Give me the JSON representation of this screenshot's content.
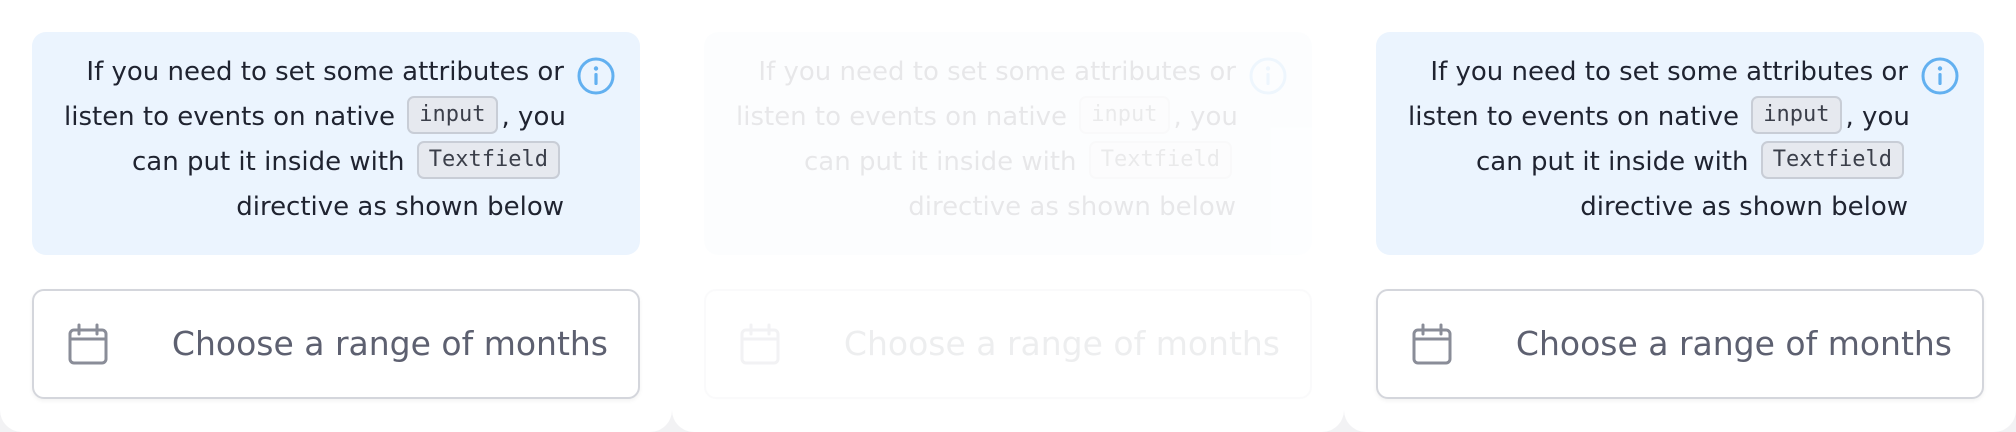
{
  "info": {
    "line1": "If you need to set some attributes or",
    "line2_pre": "listen to events on native",
    "line2_code": "input",
    "line2_post": ", you",
    "line3_pre": "can put it inside with",
    "line3_code": "Textfield",
    "line4": "directive as shown below",
    "icon": "info-icon",
    "accent_color": "#62b0f0"
  },
  "field": {
    "placeholder": "Choose a range of months",
    "icon": "calendar-icon"
  }
}
